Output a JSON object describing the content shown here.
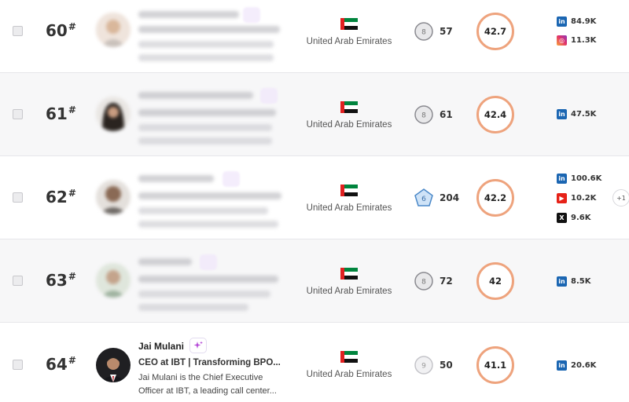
{
  "colors": {
    "score_ring": "#eea37d",
    "linkedin": "#1b66b2",
    "youtube": "#e62117",
    "x": "#111111",
    "row_shade": "#f7f7f8"
  },
  "rows": [
    {
      "rank": "60",
      "rank_mark": "#",
      "country": "United Arab Emirates",
      "flag_icon": "uae-flag",
      "level_badge": "8",
      "level_value": "57",
      "score": "42.7",
      "socials": [
        {
          "icon": "linkedin",
          "label": "in",
          "value": "84.9K"
        },
        {
          "icon": "instagram",
          "label": "◎",
          "value": "11.3K"
        }
      ]
    },
    {
      "rank": "61",
      "rank_mark": "#",
      "country": "United Arab Emirates",
      "flag_icon": "uae-flag",
      "level_badge": "8",
      "level_value": "61",
      "score": "42.4",
      "socials": [
        {
          "icon": "linkedin",
          "label": "in",
          "value": "47.5K"
        }
      ]
    },
    {
      "rank": "62",
      "rank_mark": "#",
      "country": "United Arab Emirates",
      "flag_icon": "uae-flag",
      "level_badge": "6",
      "level_value": "204",
      "score": "42.2",
      "socials": [
        {
          "icon": "linkedin",
          "label": "in",
          "value": "100.6K"
        },
        {
          "icon": "youtube",
          "label": "▶",
          "value": "10.2K"
        },
        {
          "icon": "x",
          "label": "X",
          "value": "9.6K"
        }
      ],
      "more": "+1"
    },
    {
      "rank": "63",
      "rank_mark": "#",
      "country": "United Arab Emirates",
      "flag_icon": "uae-flag",
      "level_badge": "8",
      "level_value": "72",
      "score": "42",
      "socials": [
        {
          "icon": "linkedin",
          "label": "in",
          "value": "8.5K"
        }
      ]
    },
    {
      "rank": "64",
      "rank_mark": "#",
      "name": "Jai Mulani",
      "headline": "CEO at IBT | Transforming BPO...",
      "bio": "Jai Mulani is the Chief Executive Officer at IBT, a leading call center...",
      "country": "United Arab Emirates",
      "flag_icon": "uae-flag",
      "level_badge": "9",
      "level_value": "50",
      "score": "41.1",
      "socials": [
        {
          "icon": "linkedin",
          "label": "in",
          "value": "20.6K"
        }
      ]
    }
  ]
}
